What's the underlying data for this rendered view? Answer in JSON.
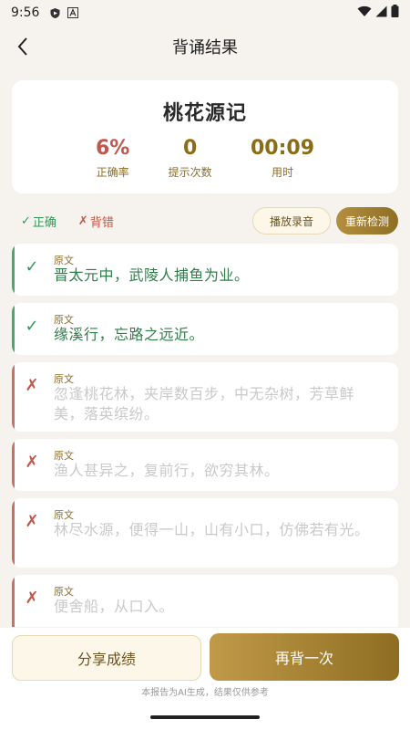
{
  "status_bar": {
    "time": "9:56"
  },
  "header": {
    "title": "背诵结果"
  },
  "summary": {
    "title": "桃花源记",
    "stats": [
      {
        "value": "6%",
        "label": "正确率"
      },
      {
        "value": "0",
        "label": "提示次数"
      },
      {
        "value": "00:09",
        "label": "用时"
      }
    ]
  },
  "legend": {
    "correct": "正确",
    "wrong": "背错"
  },
  "actions": {
    "play_recording": "播放录音",
    "recheck": "重新检测"
  },
  "items": [
    {
      "status": "correct",
      "label": "原文",
      "text": "晋太元中，武陵人捕鱼为业。"
    },
    {
      "status": "correct",
      "label": "原文",
      "text": "缘溪行，忘路之远近。"
    },
    {
      "status": "wrong",
      "label": "原文",
      "text": "忽逢桃花林，夹岸数百步，中无杂树，芳草鲜美，落英缤纷。"
    },
    {
      "status": "wrong",
      "label": "原文",
      "text": "渔人甚异之，复前行，欲穷其林。"
    },
    {
      "status": "wrong",
      "label": "原文",
      "text": "林尽水源，便得一山，山有小口，仿佛若有光。"
    },
    {
      "status": "wrong",
      "label": "原文",
      "text": "便舍船，从口入。"
    }
  ],
  "footer": {
    "share": "分享成绩",
    "retry": "再背一次",
    "disclaimer": "本报告为AI生成，结果仅供参考"
  },
  "colors": {
    "accent": "#8f6f25",
    "correct": "#2f9a57",
    "wrong": "#c0574a"
  }
}
